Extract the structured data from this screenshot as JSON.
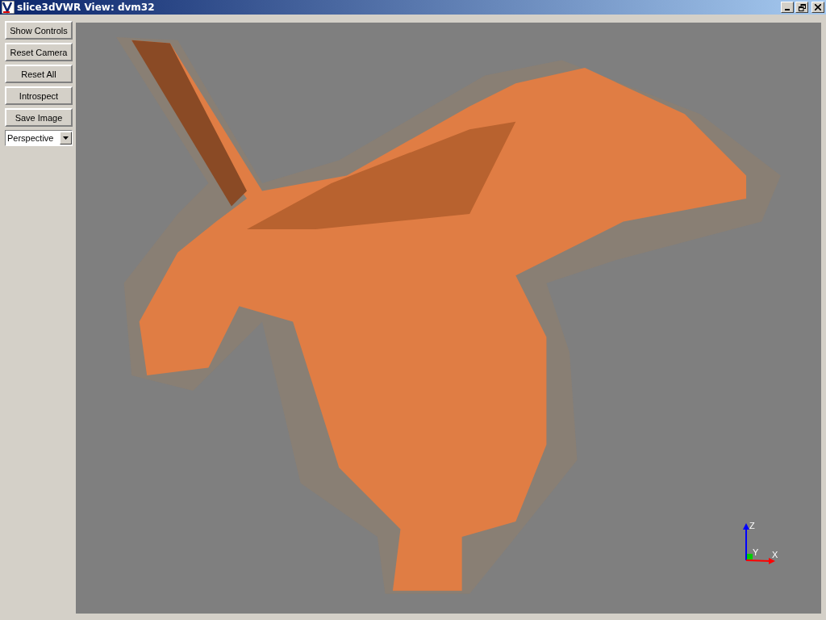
{
  "window": {
    "title": "slice3dVWR View: dvm32"
  },
  "controls": {
    "buttons": [
      "Show Controls",
      "Reset Camera",
      "Reset All",
      "Introspect",
      "Save Image"
    ],
    "projection": {
      "value": "Perspective"
    }
  },
  "viewport": {
    "axes": [
      {
        "label": "Z"
      },
      {
        "label": "Y"
      },
      {
        "label": "X"
      }
    ]
  }
}
